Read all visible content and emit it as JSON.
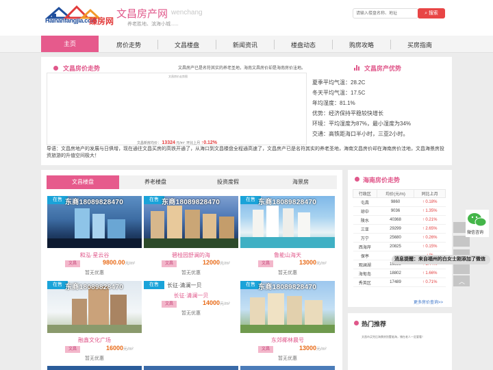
{
  "header": {
    "logo_en": "Hainanfangjia.com",
    "logo_cn": "臻房网",
    "title": "文昌房产网",
    "title_en": "wenchang",
    "slogan": "养老胜地、滨海小城......",
    "search_placeholder": "请输入楼盘名称、地址",
    "search_btn": "搜索"
  },
  "nav": [
    "主页",
    "房价走势",
    "文昌楼盘",
    "新闻资讯",
    "楼盘动态",
    "购房攻略",
    "买房指南"
  ],
  "price_section": {
    "title": "文昌房价走势",
    "right_title": "文昌房产优势",
    "note": "文昌房产已是名符其实的养老圣地，海南文昌房价却是海南房价洼地。",
    "chart_caption": "文昌房价走势图",
    "avg_label": "文昌新房均价：",
    "avg_value": "13324",
    "avg_unit": "元/m²",
    "mom_label": "环比上月",
    "mom_value": "↑0.12%"
  },
  "climate": [
    "夏季平均气温：28.2C",
    "冬天平均气温：17.5C",
    "年均湿度：81.1%",
    "优势：经济保持平稳较快增长",
    "环境：平均湿度为87%，最小湿度为34%",
    "交通：高铁距海口半小时，三亚2小时。"
  ],
  "guide": "导语：文昌房地产的发展与日俱增，现在通往文昌买房的高铁开通了，从海口到文昌楼盘全程通高速了，文昌房产已是名符其实的养老圣地，海南文昌房价却在海南房价洼地，文昌海景房投资旅游的升值空间极大！",
  "tabs": [
    "文昌楼盘",
    "养老楼盘",
    "投资度假",
    "海景房"
  ],
  "cards": [
    {
      "status": "在售",
      "phone": "东商18089828470",
      "name": "和泓·星云谷",
      "city": "文昌",
      "price": "9800.00",
      "unit": "元/m²",
      "promo": "暂无优惠"
    },
    {
      "status": "在售",
      "phone": "东商18089828470",
      "name": "碧桂园舒澜的海",
      "city": "文昌",
      "price": "12000",
      "unit": "元/m²",
      "promo": "暂无优惠"
    },
    {
      "status": "在售",
      "phone": "东商18089828470",
      "name": "鲁能山海天",
      "city": "文昌",
      "price": "13000",
      "unit": "元/m²",
      "promo": "暂无优惠"
    },
    {
      "status": "在售",
      "phone": "东商18089828470",
      "name": "融鑫文化广场",
      "city": "文昌",
      "price": "16000",
      "unit": "元/m²",
      "promo": "暂无优惠"
    },
    {
      "status": "在售",
      "phone": "长征·清澜一贝",
      "name": "长征·清澜一贝",
      "city": "文昌",
      "price": "14000",
      "unit": "元/m²",
      "promo": "暂无优惠"
    },
    {
      "status": "在售",
      "phone": "东商18089828470",
      "name": "东郊椰林晨号",
      "city": "文昌",
      "price": "13000",
      "unit": "元/m²",
      "promo": "暂无优惠"
    }
  ],
  "hainan": {
    "title": "海南房价走势",
    "headers": [
      "行政区",
      "均价(元/m)",
      "同比上月"
    ],
    "rows": [
      [
        "屯昌",
        "9860",
        "↑ 0.18%"
      ],
      [
        "琼中",
        "9036",
        "↑ 1.35%"
      ],
      [
        "陵水",
        "40368",
        "↑ 0.21%"
      ],
      [
        "三亚",
        "29299",
        "↑ 2.65%"
      ],
      [
        "万宁",
        "25680",
        "↑ 0.26%"
      ],
      [
        "西海岸",
        "20825",
        "↑ 0.15%"
      ],
      [
        "保亭",
        "",
        "↑ %"
      ],
      [
        "观澜湖",
        "19355",
        "↑ 1.44%"
      ],
      [
        "海甸岛",
        "18802",
        "↑ 1.66%"
      ],
      [
        "秀英区",
        "17489",
        "↑ 0.71%"
      ]
    ],
    "more": "更多房价查询>>"
  },
  "hot": {
    "title": "热门推荐",
    "img_alt": "文昌市买完后海景房别墅临海，铺在老人一定要看！"
  },
  "toast": "消息提醒：来自福州的白女士刚添加了微信",
  "wechat": "微信咨询"
}
